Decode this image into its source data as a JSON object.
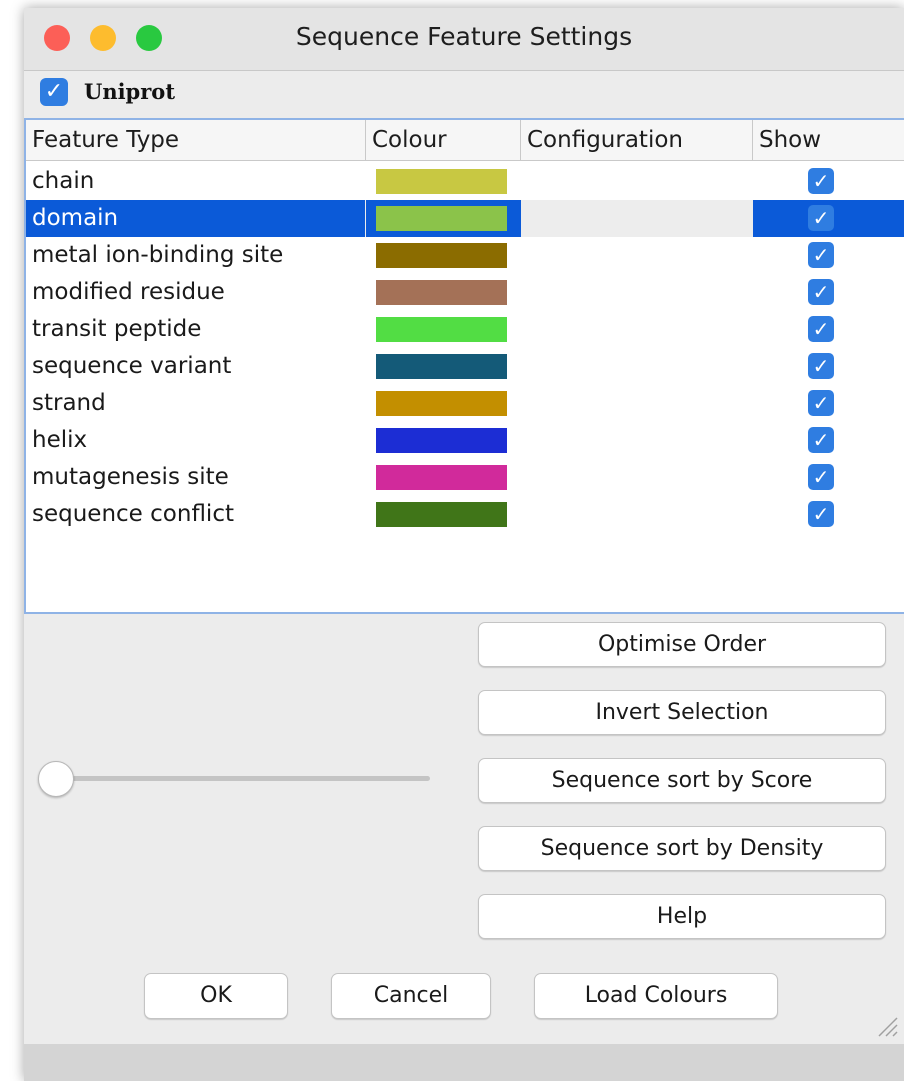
{
  "window": {
    "title": "Sequence Feature Settings"
  },
  "group": {
    "label": "Uniprot",
    "checked": true
  },
  "table": {
    "columns": [
      "Feature Type",
      "Colour",
      "Configuration",
      "Show"
    ],
    "rows": [
      {
        "name": "chain",
        "colour": "#c8c842",
        "show": true,
        "selected": false
      },
      {
        "name": "domain",
        "colour": "#8bc34a",
        "show": true,
        "selected": true
      },
      {
        "name": "metal ion-binding site",
        "colour": "#8b6c00",
        "show": true,
        "selected": false
      },
      {
        "name": "modified residue",
        "colour": "#a47157",
        "show": true,
        "selected": false
      },
      {
        "name": "transit peptide",
        "colour": "#52dd44",
        "show": true,
        "selected": false
      },
      {
        "name": "sequence variant",
        "colour": "#145a78",
        "show": true,
        "selected": false
      },
      {
        "name": "strand",
        "colour": "#c38f00",
        "show": true,
        "selected": false
      },
      {
        "name": "helix",
        "colour": "#1c2dd4",
        "show": true,
        "selected": false
      },
      {
        "name": "mutagenesis site",
        "colour": "#d12a9b",
        "show": true,
        "selected": false
      },
      {
        "name": "sequence conflict",
        "colour": "#407518",
        "show": true,
        "selected": false
      }
    ]
  },
  "slider": {
    "value": 0
  },
  "side_buttons": [
    "Optimise Order",
    "Invert Selection",
    "Sequence sort by Score",
    "Sequence sort by Density",
    "Help"
  ],
  "bottom_buttons": {
    "ok": "OK",
    "cancel": "Cancel",
    "load": "Load Colours"
  },
  "colors": {
    "selection": "#0b5ad8",
    "checkbox": "#2f7de1"
  }
}
